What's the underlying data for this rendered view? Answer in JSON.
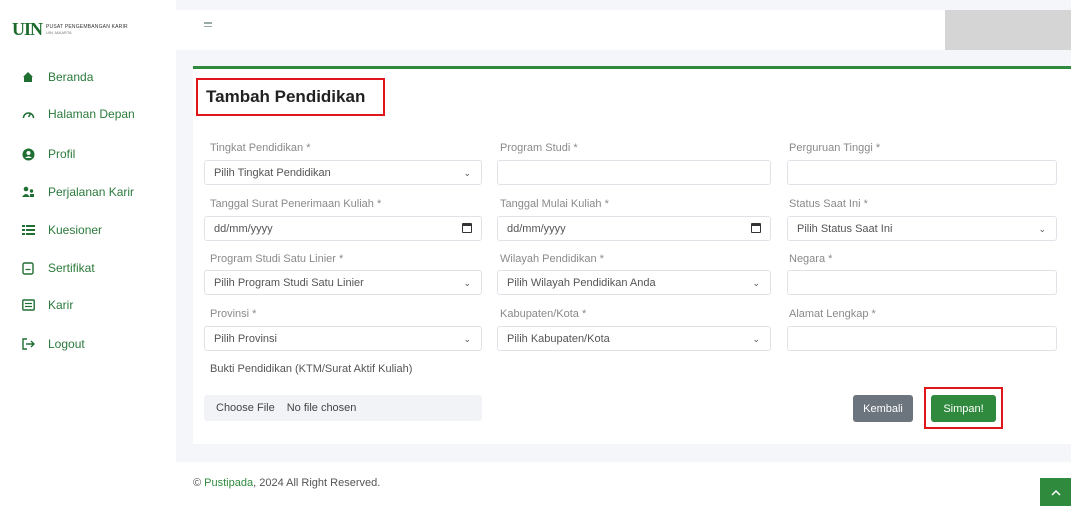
{
  "brand": {
    "logo_mark": "UIN",
    "logo_line1": "PUSAT PENGEMBANGAN KARIR",
    "logo_line2": "UIN JAKARTA"
  },
  "sidebar": {
    "items": [
      {
        "label": "Beranda",
        "icon": "home-icon"
      },
      {
        "label": "Halaman Depan",
        "icon": "dashboard-icon"
      },
      {
        "label": "Profil",
        "icon": "user-circle-icon"
      },
      {
        "label": "Perjalanan Karir",
        "icon": "users-icon"
      },
      {
        "label": "Kuesioner",
        "icon": "list-icon"
      },
      {
        "label": "Sertifikat",
        "icon": "certificate-icon"
      },
      {
        "label": "Karir",
        "icon": "briefcase-icon"
      },
      {
        "label": "Logout",
        "icon": "logout-icon"
      }
    ]
  },
  "page": {
    "title": "Tambah Pendidikan"
  },
  "form": {
    "tingkat_label": "Tingkat Pendidikan *",
    "tingkat_value": "Pilih Tingkat Pendidikan",
    "prodi_label": "Program Studi *",
    "prodi_value": "",
    "pt_label": "Perguruan Tinggi *",
    "pt_value": "",
    "tgl_surat_label": "Tanggal Surat Penerimaan Kuliah *",
    "tgl_surat_value": "dd/mm/yyyy",
    "tgl_mulai_label": "Tanggal Mulai Kuliah *",
    "tgl_mulai_value": "dd/mm/yyyy",
    "status_label": "Status Saat Ini *",
    "status_value": "Pilih Status Saat Ini",
    "linier_label": "Program Studi Satu Linier *",
    "linier_value": "Pilih Program Studi Satu Linier",
    "wilayah_label": "Wilayah Pendidikan *",
    "wilayah_value": "Pilih Wilayah Pendidikan Anda",
    "negara_label": "Negara *",
    "negara_value": "",
    "provinsi_label": "Provinsi *",
    "provinsi_value": "Pilih Provinsi",
    "kabupaten_label": "Kabupaten/Kota *",
    "kabupaten_value": "Pilih Kabupaten/Kota",
    "alamat_label": "Alamat Lengkap *",
    "alamat_value": "",
    "bukti_label": "Bukti Pendidikan (KTM/Surat Aktif Kuliah)",
    "file_button": "Choose File",
    "file_status": "No file chosen"
  },
  "actions": {
    "back_label": "Kembali",
    "save_label": "Simpan!"
  },
  "footer": {
    "prefix": "© ",
    "brand": "Pustipada",
    "rest": ", 2024 All Right Reserved."
  },
  "colors": {
    "accent": "#2f8a3e",
    "highlight": "#e0161b",
    "secondary_button": "#6c757d"
  }
}
